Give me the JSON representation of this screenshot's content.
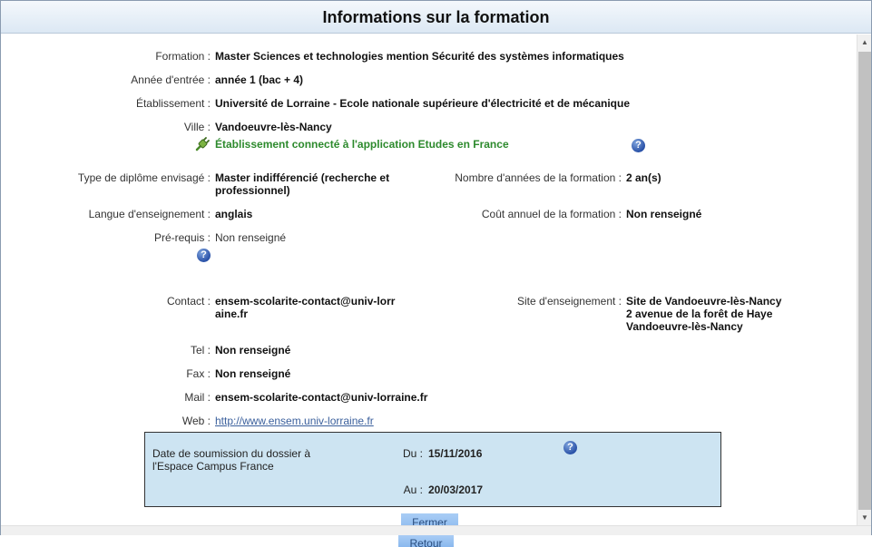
{
  "title": "Informations sur la formation",
  "fields": {
    "formation": {
      "label": "Formation :",
      "value": "Master Sciences et technologies mention Sécurité des systèmes informatiques"
    },
    "annee": {
      "label": "Année d'entrée :",
      "value": "année 1 (bac + 4)"
    },
    "etablissement": {
      "label": "Établissement :",
      "value": "Université de Lorraine - Ecole nationale supérieure d'électricité et de mécanique"
    },
    "ville": {
      "label": "Ville :",
      "value": "Vandoeuvre-lès-Nancy"
    },
    "connected": "Établissement connecté à l'application Etudes en France",
    "type_diplome": {
      "label": "Type de diplôme envisagé :",
      "value": "Master indifférencié (recherche et professionnel)"
    },
    "nb_annees": {
      "label": "Nombre d'années de la formation :",
      "value": "2 an(s)"
    },
    "langue": {
      "label": "Langue d'enseignement :",
      "value": "anglais"
    },
    "cout": {
      "label": "Coût annuel de la formation :",
      "value": "Non renseigné"
    },
    "prerequis": {
      "label": "Pré-requis :",
      "value": "Non renseigné"
    },
    "contact": {
      "label": "Contact :",
      "value": "ensem-scolarite-contact@univ-lorraine.fr"
    },
    "site": {
      "label": "Site d'enseignement :",
      "line1": "Site de Vandoeuvre-lès-Nancy",
      "line2": "2 avenue de la forêt de Haye",
      "line3": "Vandoeuvre-lès-Nancy"
    },
    "tel": {
      "label": "Tel :",
      "value": "Non renseigné"
    },
    "fax": {
      "label": "Fax :",
      "value": "Non renseigné"
    },
    "mail": {
      "label": "Mail :",
      "value": "ensem-scolarite-contact@univ-lorraine.fr"
    },
    "web": {
      "label": "Web :",
      "value": "http://www.ensem.univ-lorraine.fr"
    }
  },
  "dates": {
    "label_line1": "Date de soumission du dossier à",
    "label_line2": "l'Espace Campus France",
    "du_label": "Du :",
    "du_value": "15/11/2016",
    "au_label": "Au :",
    "au_value": "20/03/2017"
  },
  "buttons": {
    "fermer": "Fermer",
    "retour": "Retour"
  },
  "icons": {
    "help": "help-icon",
    "plug": "plug-icon"
  },
  "colors": {
    "title_bg": "#dce8f4",
    "connected_text": "#2d8a2d",
    "date_box_bg": "#cde4f2",
    "button_bg": "#8ab8ee",
    "link": "#3a5f9c"
  }
}
